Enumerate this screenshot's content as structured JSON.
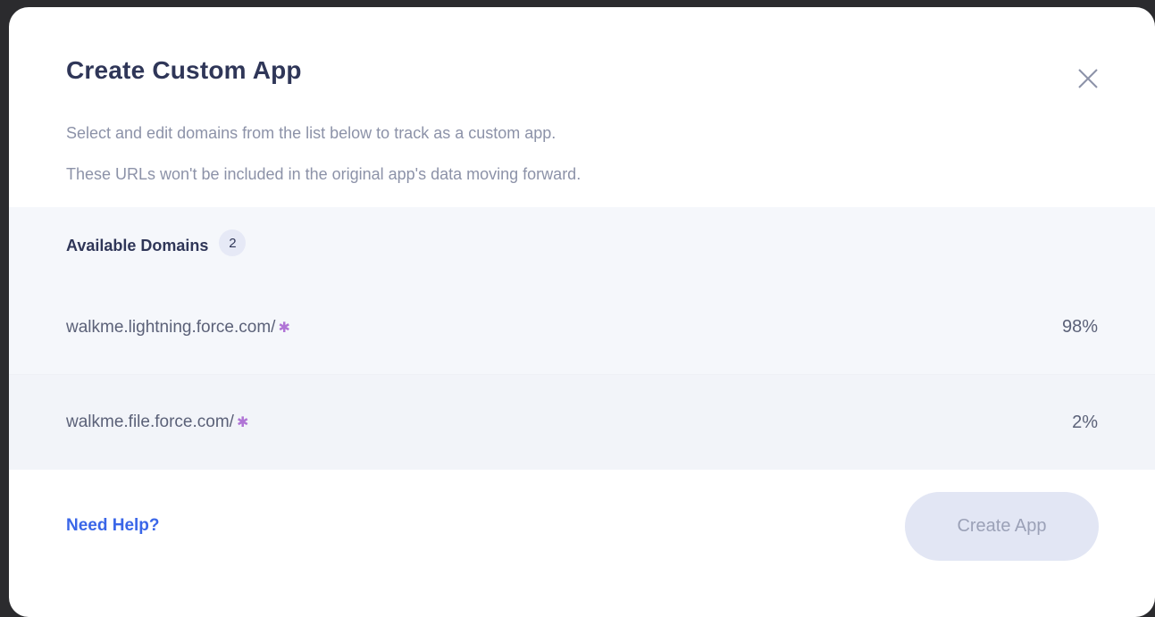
{
  "modal": {
    "title": "Create Custom App",
    "description_line1": "Select and edit domains from the list below to track as a custom app.",
    "description_line2": "These URLs won't be included in the original app's data moving forward.",
    "close_icon": "close-icon"
  },
  "domains": {
    "header": "Available Domains",
    "count": "2",
    "items": [
      {
        "domain": "walkme.lightning.force.com/",
        "wildcard": "✱",
        "percent": "98%"
      },
      {
        "domain": "walkme.file.force.com/",
        "wildcard": "✱",
        "percent": "2%"
      }
    ]
  },
  "footer": {
    "help_link": "Need Help?",
    "create_button": "Create App"
  },
  "colors": {
    "title": "#2f3658",
    "link": "#3a66e8",
    "wildcard": "#b074d6",
    "disabled_button_bg": "#e2e6f4"
  }
}
